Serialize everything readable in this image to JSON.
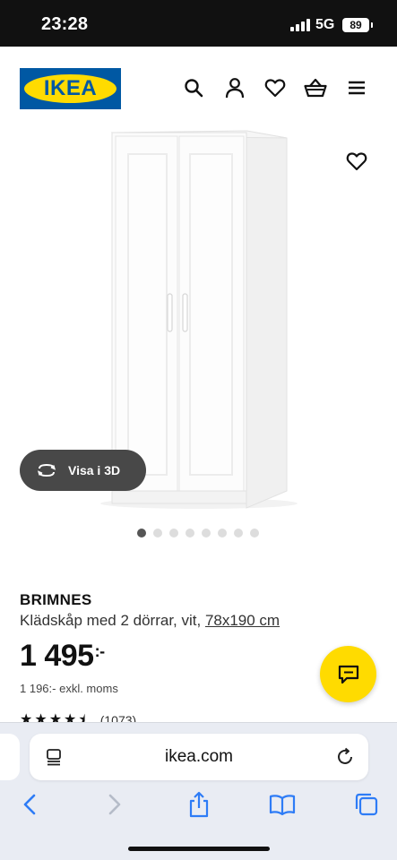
{
  "status_bar": {
    "time": "23:28",
    "network": "5G",
    "battery": "89"
  },
  "header": {
    "logo_text": "IKEA",
    "icons": [
      "search-icon",
      "account-icon",
      "heart-icon",
      "basket-icon",
      "menu-icon"
    ]
  },
  "product": {
    "view_3d_label": "Visa i 3D",
    "gallery_total": 8,
    "gallery_active": 1,
    "name": "BRIMNES",
    "description": "Klädskåp med 2 dörrar, vit, ",
    "size_link": "78x190 cm",
    "price": "1 495",
    "price_suffix": ":-",
    "price_excl": "1 196:- exkl. moms",
    "rating_stars": 4.5,
    "rating_count": "(1073)"
  },
  "browser": {
    "url": "ikea.com",
    "toolbar": [
      "back-icon",
      "forward-icon",
      "share-icon",
      "bookmarks-icon",
      "tabs-icon"
    ]
  },
  "colors": {
    "ikea_blue": "#0058a3",
    "ikea_yellow": "#ffdb00",
    "pill_bg": "#484848"
  }
}
